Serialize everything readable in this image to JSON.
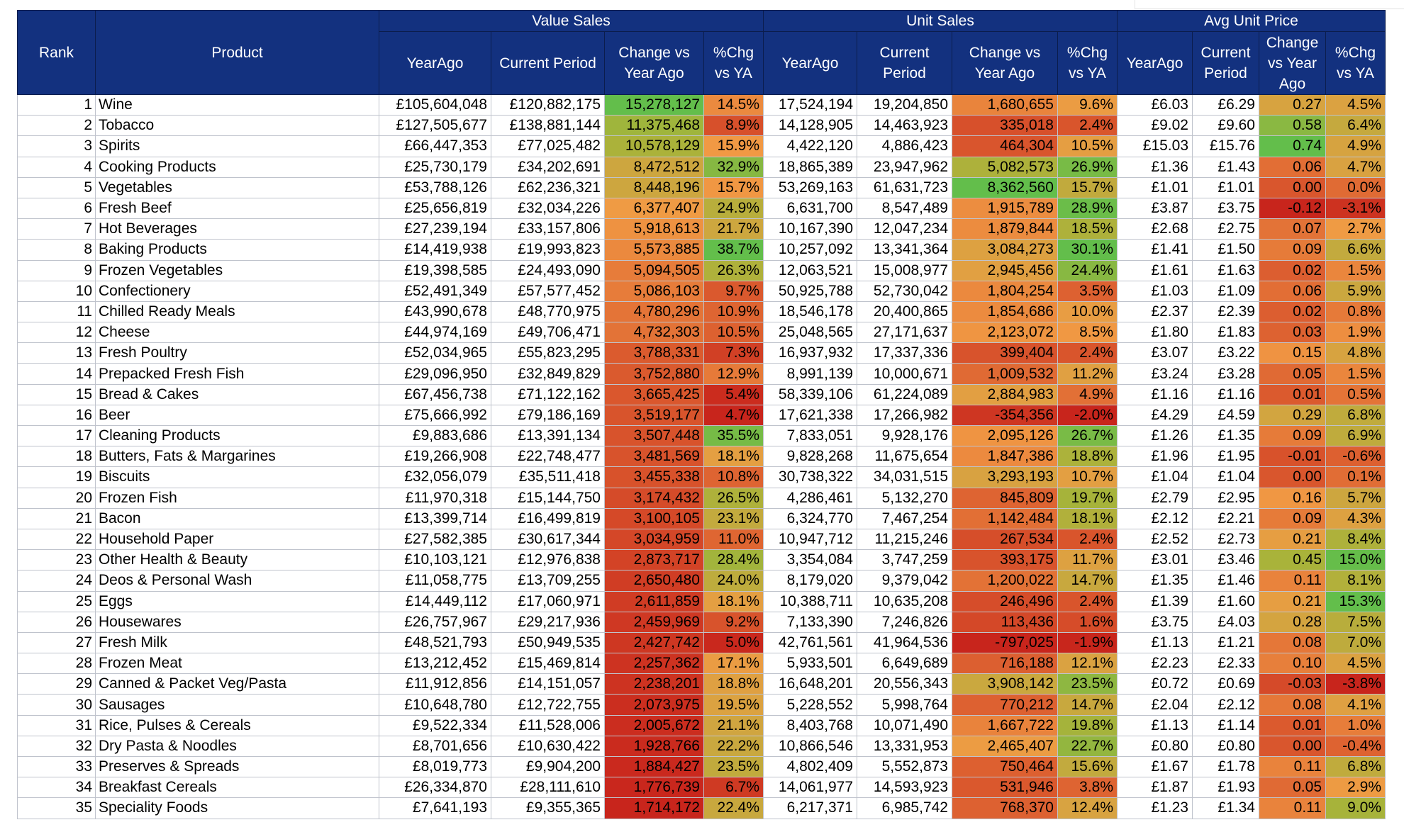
{
  "header": {
    "rank": "Rank",
    "product": "Product",
    "groups": [
      "Value Sales",
      "Unit Sales",
      "Avg Unit Price"
    ],
    "sub": [
      "YearAgo",
      "Current Period",
      "Change vs Year Ago",
      "%Chg vs YA",
      "YearAgo",
      "Current Period",
      "Change vs Year Ago",
      "%Chg vs YA",
      "YearAgo",
      "Current Period",
      "Change vs Year Ago",
      "%Chg vs YA"
    ]
  },
  "colors": {
    "header_bg": "#13317f",
    "scale_high": "#63be4b",
    "scale_mid": "#a8b33a",
    "scale_orange": "#f19a44",
    "scale_low": "#c8251c"
  },
  "rows": [
    [
      "1",
      "Wine",
      "£105,604,048",
      "£120,882,175",
      "15,278,127",
      "14.5%",
      "17,524,194",
      "19,204,850",
      "1,680,655",
      "9.6%",
      "£6.03",
      "£6.29",
      "0.27",
      "4.5%"
    ],
    [
      "2",
      "Tobacco",
      "£127,505,677",
      "£138,881,144",
      "11,375,468",
      "8.9%",
      "14,128,905",
      "14,463,923",
      "335,018",
      "2.4%",
      "£9.02",
      "£9.60",
      "0.58",
      "6.4%"
    ],
    [
      "3",
      "Spirits",
      "£66,447,353",
      "£77,025,482",
      "10,578,129",
      "15.9%",
      "4,422,120",
      "4,886,423",
      "464,304",
      "10.5%",
      "£15.03",
      "£15.76",
      "0.74",
      "4.9%"
    ],
    [
      "4",
      "Cooking Products",
      "£25,730,179",
      "£34,202,691",
      "8,472,512",
      "32.9%",
      "18,865,389",
      "23,947,962",
      "5,082,573",
      "26.9%",
      "£1.36",
      "£1.43",
      "0.06",
      "4.7%"
    ],
    [
      "5",
      "Vegetables",
      "£53,788,126",
      "£62,236,321",
      "8,448,196",
      "15.7%",
      "53,269,163",
      "61,631,723",
      "8,362,560",
      "15.7%",
      "£1.01",
      "£1.01",
      "0.00",
      "0.0%"
    ],
    [
      "6",
      "Fresh Beef",
      "£25,656,819",
      "£32,034,226",
      "6,377,407",
      "24.9%",
      "6,631,700",
      "8,547,489",
      "1,915,789",
      "28.9%",
      "£3.87",
      "£3.75",
      "-0.12",
      "-3.1%"
    ],
    [
      "7",
      "Hot Beverages",
      "£27,239,194",
      "£33,157,806",
      "5,918,613",
      "21.7%",
      "10,167,390",
      "12,047,234",
      "1,879,844",
      "18.5%",
      "£2.68",
      "£2.75",
      "0.07",
      "2.7%"
    ],
    [
      "8",
      "Baking Products",
      "£14,419,938",
      "£19,993,823",
      "5,573,885",
      "38.7%",
      "10,257,092",
      "13,341,364",
      "3,084,273",
      "30.1%",
      "£1.41",
      "£1.50",
      "0.09",
      "6.6%"
    ],
    [
      "9",
      "Frozen Vegetables",
      "£19,398,585",
      "£24,493,090",
      "5,094,505",
      "26.3%",
      "12,063,521",
      "15,008,977",
      "2,945,456",
      "24.4%",
      "£1.61",
      "£1.63",
      "0.02",
      "1.5%"
    ],
    [
      "10",
      "Confectionery",
      "£52,491,349",
      "£57,577,452",
      "5,086,103",
      "9.7%",
      "50,925,788",
      "52,730,042",
      "1,804,254",
      "3.5%",
      "£1.03",
      "£1.09",
      "0.06",
      "5.9%"
    ],
    [
      "11",
      "Chilled Ready Meals",
      "£43,990,678",
      "£48,770,975",
      "4,780,296",
      "10.9%",
      "18,546,178",
      "20,400,865",
      "1,854,686",
      "10.0%",
      "£2.37",
      "£2.39",
      "0.02",
      "0.8%"
    ],
    [
      "12",
      "Cheese",
      "£44,974,169",
      "£49,706,471",
      "4,732,303",
      "10.5%",
      "25,048,565",
      "27,171,637",
      "2,123,072",
      "8.5%",
      "£1.80",
      "£1.83",
      "0.03",
      "1.9%"
    ],
    [
      "13",
      "Fresh Poultry",
      "£52,034,965",
      "£55,823,295",
      "3,788,331",
      "7.3%",
      "16,937,932",
      "17,337,336",
      "399,404",
      "2.4%",
      "£3.07",
      "£3.22",
      "0.15",
      "4.8%"
    ],
    [
      "14",
      "Prepacked Fresh Fish",
      "£29,096,950",
      "£32,849,829",
      "3,752,880",
      "12.9%",
      "8,991,139",
      "10,000,671",
      "1,009,532",
      "11.2%",
      "£3.24",
      "£3.28",
      "0.05",
      "1.5%"
    ],
    [
      "15",
      "Bread & Cakes",
      "£67,456,738",
      "£71,122,162",
      "3,665,425",
      "5.4%",
      "58,339,106",
      "61,224,089",
      "2,884,983",
      "4.9%",
      "£1.16",
      "£1.16",
      "0.01",
      "0.5%"
    ],
    [
      "16",
      "Beer",
      "£75,666,992",
      "£79,186,169",
      "3,519,177",
      "4.7%",
      "17,621,338",
      "17,266,982",
      "-354,356",
      "-2.0%",
      "£4.29",
      "£4.59",
      "0.29",
      "6.8%"
    ],
    [
      "17",
      "Cleaning Products",
      "£9,883,686",
      "£13,391,134",
      "3,507,448",
      "35.5%",
      "7,833,051",
      "9,928,176",
      "2,095,126",
      "26.7%",
      "£1.26",
      "£1.35",
      "0.09",
      "6.9%"
    ],
    [
      "18",
      "Butters, Fats & Margarines",
      "£19,266,908",
      "£22,748,477",
      "3,481,569",
      "18.1%",
      "9,828,268",
      "11,675,654",
      "1,847,386",
      "18.8%",
      "£1.96",
      "£1.95",
      "-0.01",
      "-0.6%"
    ],
    [
      "19",
      "Biscuits",
      "£32,056,079",
      "£35,511,418",
      "3,455,338",
      "10.8%",
      "30,738,322",
      "34,031,515",
      "3,293,193",
      "10.7%",
      "£1.04",
      "£1.04",
      "0.00",
      "0.1%"
    ],
    [
      "20",
      "Frozen Fish",
      "£11,970,318",
      "£15,144,750",
      "3,174,432",
      "26.5%",
      "4,286,461",
      "5,132,270",
      "845,809",
      "19.7%",
      "£2.79",
      "£2.95",
      "0.16",
      "5.7%"
    ],
    [
      "21",
      "Bacon",
      "£13,399,714",
      "£16,499,819",
      "3,100,105",
      "23.1%",
      "6,324,770",
      "7,467,254",
      "1,142,484",
      "18.1%",
      "£2.12",
      "£2.21",
      "0.09",
      "4.3%"
    ],
    [
      "22",
      "Household Paper",
      "£27,582,385",
      "£30,617,344",
      "3,034,959",
      "11.0%",
      "10,947,712",
      "11,215,246",
      "267,534",
      "2.4%",
      "£2.52",
      "£2.73",
      "0.21",
      "8.4%"
    ],
    [
      "23",
      "Other Health & Beauty",
      "£10,103,121",
      "£12,976,838",
      "2,873,717",
      "28.4%",
      "3,354,084",
      "3,747,259",
      "393,175",
      "11.7%",
      "£3.01",
      "£3.46",
      "0.45",
      "15.0%"
    ],
    [
      "24",
      "Deos & Personal Wash",
      "£11,058,775",
      "£13,709,255",
      "2,650,480",
      "24.0%",
      "8,179,020",
      "9,379,042",
      "1,200,022",
      "14.7%",
      "£1.35",
      "£1.46",
      "0.11",
      "8.1%"
    ],
    [
      "25",
      "Eggs",
      "£14,449,112",
      "£17,060,971",
      "2,611,859",
      "18.1%",
      "10,388,711",
      "10,635,208",
      "246,496",
      "2.4%",
      "£1.39",
      "£1.60",
      "0.21",
      "15.3%"
    ],
    [
      "26",
      "Housewares",
      "£26,757,967",
      "£29,217,936",
      "2,459,969",
      "9.2%",
      "7,133,390",
      "7,246,826",
      "113,436",
      "1.6%",
      "£3.75",
      "£4.03",
      "0.28",
      "7.5%"
    ],
    [
      "27",
      "Fresh Milk",
      "£48,521,793",
      "£50,949,535",
      "2,427,742",
      "5.0%",
      "42,761,561",
      "41,964,536",
      "-797,025",
      "-1.9%",
      "£1.13",
      "£1.21",
      "0.08",
      "7.0%"
    ],
    [
      "28",
      "Frozen Meat",
      "£13,212,452",
      "£15,469,814",
      "2,257,362",
      "17.1%",
      "5,933,501",
      "6,649,689",
      "716,188",
      "12.1%",
      "£2.23",
      "£2.33",
      "0.10",
      "4.5%"
    ],
    [
      "29",
      "Canned & Packet Veg/Pasta",
      "£11,912,856",
      "£14,151,057",
      "2,238,201",
      "18.8%",
      "16,648,201",
      "20,556,343",
      "3,908,142",
      "23.5%",
      "£0.72",
      "£0.69",
      "-0.03",
      "-3.8%"
    ],
    [
      "30",
      "Sausages",
      "£10,648,780",
      "£12,722,755",
      "2,073,975",
      "19.5%",
      "5,228,552",
      "5,998,764",
      "770,212",
      "14.7%",
      "£2.04",
      "£2.12",
      "0.08",
      "4.1%"
    ],
    [
      "31",
      "Rice, Pulses & Cereals",
      "£9,522,334",
      "£11,528,006",
      "2,005,672",
      "21.1%",
      "8,403,768",
      "10,071,490",
      "1,667,722",
      "19.8%",
      "£1.13",
      "£1.14",
      "0.01",
      "1.0%"
    ],
    [
      "32",
      "Dry Pasta & Noodles",
      "£8,701,656",
      "£10,630,422",
      "1,928,766",
      "22.2%",
      "10,866,546",
      "13,331,953",
      "2,465,407",
      "22.7%",
      "£0.80",
      "£0.80",
      "0.00",
      "-0.4%"
    ],
    [
      "33",
      "Preserves & Spreads",
      "£8,019,773",
      "£9,904,200",
      "1,884,427",
      "23.5%",
      "4,802,409",
      "5,552,873",
      "750,464",
      "15.6%",
      "£1.67",
      "£1.78",
      "0.11",
      "6.8%"
    ],
    [
      "34",
      "Breakfast Cereals",
      "£26,334,870",
      "£28,111,610",
      "1,776,739",
      "6.7%",
      "14,061,977",
      "14,593,923",
      "531,946",
      "3.8%",
      "£1.87",
      "£1.93",
      "0.05",
      "2.9%"
    ],
    [
      "35",
      "Speciality Foods",
      "£7,641,193",
      "£9,355,365",
      "1,714,172",
      "22.4%",
      "6,217,371",
      "6,985,742",
      "768,370",
      "12.4%",
      "£1.23",
      "£1.34",
      "0.11",
      "9.0%"
    ]
  ]
}
